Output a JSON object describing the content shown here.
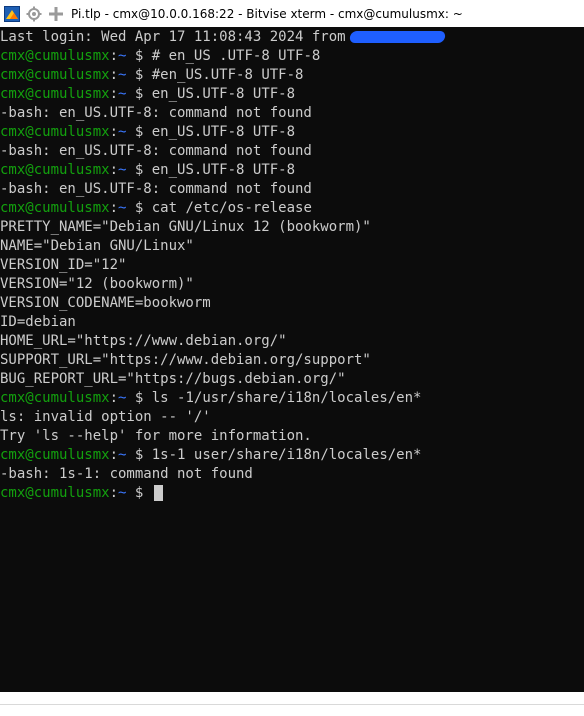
{
  "window": {
    "title": "Pi.tlp - cmx@10.0.0.168:22 - Bitvise xterm - cmx@cumulusmx: ~",
    "icons": [
      "bitvise-logo-icon",
      "gear-icon",
      "move-icon"
    ]
  },
  "terminal": {
    "login_line": "Last login: Wed Apr 17 11:08:43 2024 from",
    "prompt": {
      "user": "cmx@cumulusmx",
      "sep": ":",
      "path": "~",
      "symbol": " $ "
    },
    "lines": [
      {
        "type": "prompt",
        "command": "# en_US .UTF-8 UTF-8"
      },
      {
        "type": "prompt",
        "command": "#en_US.UTF-8 UTF-8"
      },
      {
        "type": "prompt",
        "command": "en_US.UTF-8 UTF-8"
      },
      {
        "type": "output",
        "text": "-bash: en_US.UTF-8: command not found"
      },
      {
        "type": "prompt",
        "command": "en_US.UTF-8 UTF-8"
      },
      {
        "type": "output",
        "text": "-bash: en_US.UTF-8: command not found"
      },
      {
        "type": "prompt",
        "command": "en_US.UTF-8 UTF-8"
      },
      {
        "type": "output",
        "text": "-bash: en_US.UTF-8: command not found"
      },
      {
        "type": "prompt",
        "command": "cat /etc/os-release"
      },
      {
        "type": "output",
        "text": "PRETTY_NAME=\"Debian GNU/Linux 12 (bookworm)\""
      },
      {
        "type": "output",
        "text": "NAME=\"Debian GNU/Linux\""
      },
      {
        "type": "output",
        "text": "VERSION_ID=\"12\""
      },
      {
        "type": "output",
        "text": "VERSION=\"12 (bookworm)\""
      },
      {
        "type": "output",
        "text": "VERSION_CODENAME=bookworm"
      },
      {
        "type": "output",
        "text": "ID=debian"
      },
      {
        "type": "output",
        "text": "HOME_URL=\"https://www.debian.org/\""
      },
      {
        "type": "output",
        "text": "SUPPORT_URL=\"https://www.debian.org/support\""
      },
      {
        "type": "output",
        "text": "BUG_REPORT_URL=\"https://bugs.debian.org/\""
      },
      {
        "type": "prompt",
        "command": "ls -1/usr/share/i18n/locales/en*"
      },
      {
        "type": "output",
        "text": "ls: invalid option -- '/'"
      },
      {
        "type": "output",
        "text": "Try 'ls --help' for more information."
      },
      {
        "type": "prompt",
        "command": "1s-1 user/share/i18n/locales/en*"
      },
      {
        "type": "output",
        "text": "-bash: 1s-1: command not found"
      },
      {
        "type": "prompt",
        "command": "",
        "cursor": true
      }
    ]
  },
  "colors": {
    "terminal_bg": "#0c0c0c",
    "text": "#cccccc",
    "prompt_user": "#13a10e",
    "prompt_path": "#3b78ff",
    "redaction": "#1f5fff"
  }
}
